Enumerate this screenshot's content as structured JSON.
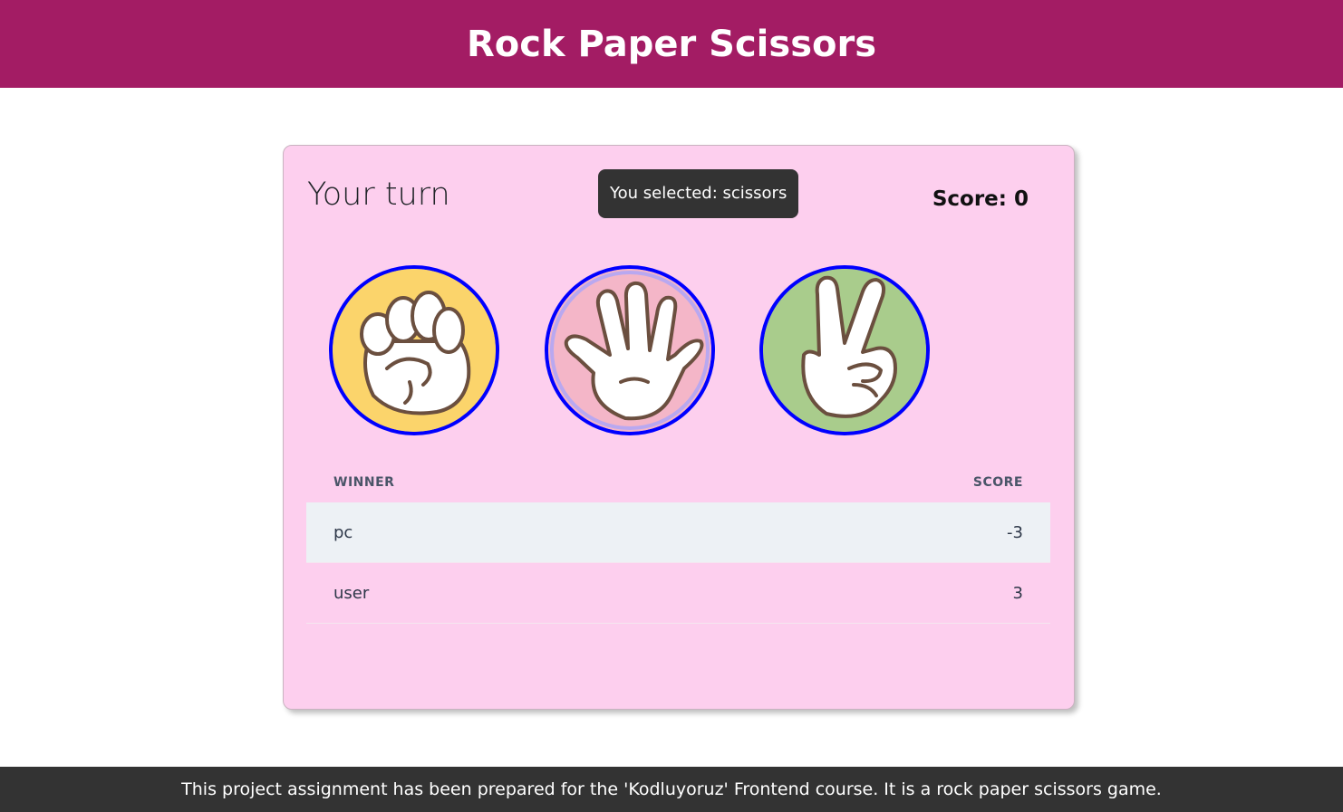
{
  "header": {
    "title": "Rock Paper Scissors"
  },
  "game": {
    "turn_label": "Your turn",
    "toast_message": "You selected: scissors",
    "score_label": "Score: 0",
    "choices": [
      {
        "name": "rock",
        "icon": "fist-hand-icon",
        "background": "#fbd46b"
      },
      {
        "name": "paper",
        "icon": "open-hand-icon",
        "background": "#f4b6c8"
      },
      {
        "name": "scissors",
        "icon": "peace-hand-icon",
        "background": "#a9cc8c"
      }
    ],
    "choice_border_color": "#0000ff"
  },
  "table": {
    "headers": {
      "winner": "WINNER",
      "score": "SCORE"
    },
    "rows": [
      {
        "winner": "pc",
        "score": "-3"
      },
      {
        "winner": "user",
        "score": "3"
      }
    ]
  },
  "footer": {
    "text": "This project assignment has been prepared for the 'Kodluyoruz' Frontend course. It is a rock paper scissors game."
  },
  "colors": {
    "header_bg": "#a31c64",
    "card_bg": "#fdcfee",
    "footer_bg": "#333333",
    "toast_bg": "#333333"
  }
}
